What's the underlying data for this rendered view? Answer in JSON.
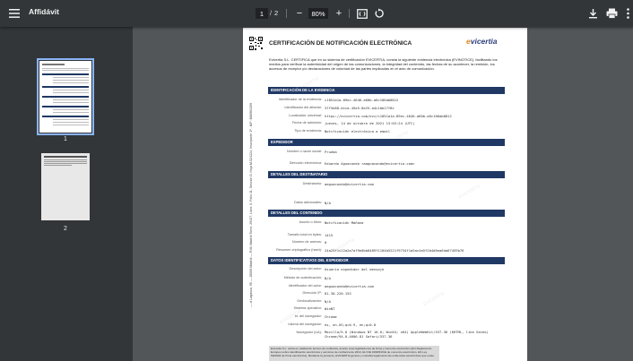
{
  "toolbar": {
    "title": "Affidávit",
    "current_page": "1",
    "page_separator": "/",
    "total_pages": "2",
    "zoom": "80%",
    "zoom_out_label": "−",
    "zoom_in_label": "+"
  },
  "icons": {
    "menu": "menu-icon",
    "fit": "fit-page-icon",
    "rotate": "rotate-icon",
    "download": "download-icon",
    "print": "print-icon",
    "more": "more-vert-icon"
  },
  "thumbnails": [
    {
      "number": "1"
    },
    {
      "number": "2"
    }
  ],
  "document": {
    "title": "CERTIFICACIÓN DE NOTIFICACIÓN ELECTRÓNICA",
    "logo_prefix": "e",
    "logo_main": "vicertia",
    "intro": "Evicertia S.L. CERTIFICA que en su sistema de certificación EVICERTIA, consta la siguiente evidencia electrónica (EVINOTICE), facilitando los medios para verificar la autenticidad del origen de las comunicaciones, la integridad del contenido, las fechas de su acontecer, la remisión, los accesos de receptor y/o declaraciones de voluntad de las partes implicadas en el acto de comunicación.",
    "side_text": "— cl Lagasca, 95 — 28006 Madrid — R.M. Madrid Tomo: 29137, Libro: 0, Folio 11, Sección 8, Hoja M-524224, Inscripción 1ª - NIF: B86961309",
    "sections": [
      {
        "header": "IDENTIFICACIÓN DE LA EVIDENCIA",
        "fields": [
          {
            "label": "Identificador de la evidencia:",
            "value": "c1851a1a-89ec-4646-a60b-a6c106ab8812"
          },
          {
            "label": "Identificador del albarán:",
            "value": "37f5e88-dcca-45e5-8e25-a4c1bb17f8c"
          },
          {
            "label": "Localizador universal:",
            "value": "https://evicertia.com/evi/c1851a1a-89ec-4646-a60b-a6c106ab8812"
          },
          {
            "label": "Fecha de admisión:",
            "value": "jueves, 14 de octubre de 2021 13:03:24 (UTC)"
          },
          {
            "label": "Tipo de evidencia:",
            "value": "Notificación electrónica a email"
          }
        ]
      },
      {
        "header": "EXPEDIDOR",
        "fields": [
          {
            "label": "Nombre o razón social:",
            "value": "Prueba"
          },
          {
            "label": "Dirección electrónica:",
            "value": "Eduardo Aguacondo <aaguacondo@evicertia.com>"
          }
        ]
      },
      {
        "header": "DETALLES DEL DESTINATARIO",
        "fields": [
          {
            "label": "Destinatario:",
            "value": "aaguacondo@evicertia.com"
          },
          {
            "label": "Datos adicionales:",
            "value": "N/A"
          }
        ]
      },
      {
        "header": "DETALLES DEL CONTENIDO",
        "fields": [
          {
            "label": "Asunto o título:",
            "value": "Notificación Mañana"
          },
          {
            "label": "Tamaño total en bytes:",
            "value": "1415"
          },
          {
            "label": "Número de anexos:",
            "value": "0"
          },
          {
            "label": "Resumen criptográfico (hash):",
            "value": "24a25f1c22a2a7af9e0bb0489f1104b5221f9734f1a5ac4a5f2b4d6ea6da67459b76"
          }
        ]
      },
      {
        "header": "DATOS IDENTIFICATIVOS DEL EXPEDIDOR",
        "fields": [
          {
            "label": "Descripción del actor:",
            "value": "Usuario expedidor del mensaje"
          },
          {
            "label": "Método de autenticación:",
            "value": "N/A"
          },
          {
            "label": "Identificador del actor:",
            "value": "aaguacondo@evicertia.com"
          },
          {
            "label": "Dirección IP:",
            "value": "81.30.220.153"
          },
          {
            "label": "Geolocalización:",
            "value": "N/A"
          },
          {
            "label": "Sistema operativo:",
            "value": "WinNT"
          },
          {
            "label": "Id. del navegador:",
            "value": "Chrome"
          },
          {
            "label": "Idioma del navegador:",
            "value": "es, en-US;q=0.9, en;q=0.8"
          },
          {
            "label": "Navegador (UA):",
            "value": "Mozilla/5.0 (Windows NT 10.0; Win64; x64) AppleWebKit/537.36 (KHTML, like Gecko) Chrome/94.0.4606.81 Safari/537.36"
          }
        ]
      }
    ],
    "footer_note": "Evicertia S.L. actúa en calidad de tercero de confianza, acorde a las legislaciones de firma y comercio electrónico (EU Reglamento Europeo sobre identificación electrónica y servicios de confianza de 2014, EU DE 1999/93/CE de comercio electrónico, ES Ley 59/2003 de firma electrónica). Mediante la presente, EVICERTIA genera y custodia legalmente las evidencias electrónicas que emite."
  }
}
